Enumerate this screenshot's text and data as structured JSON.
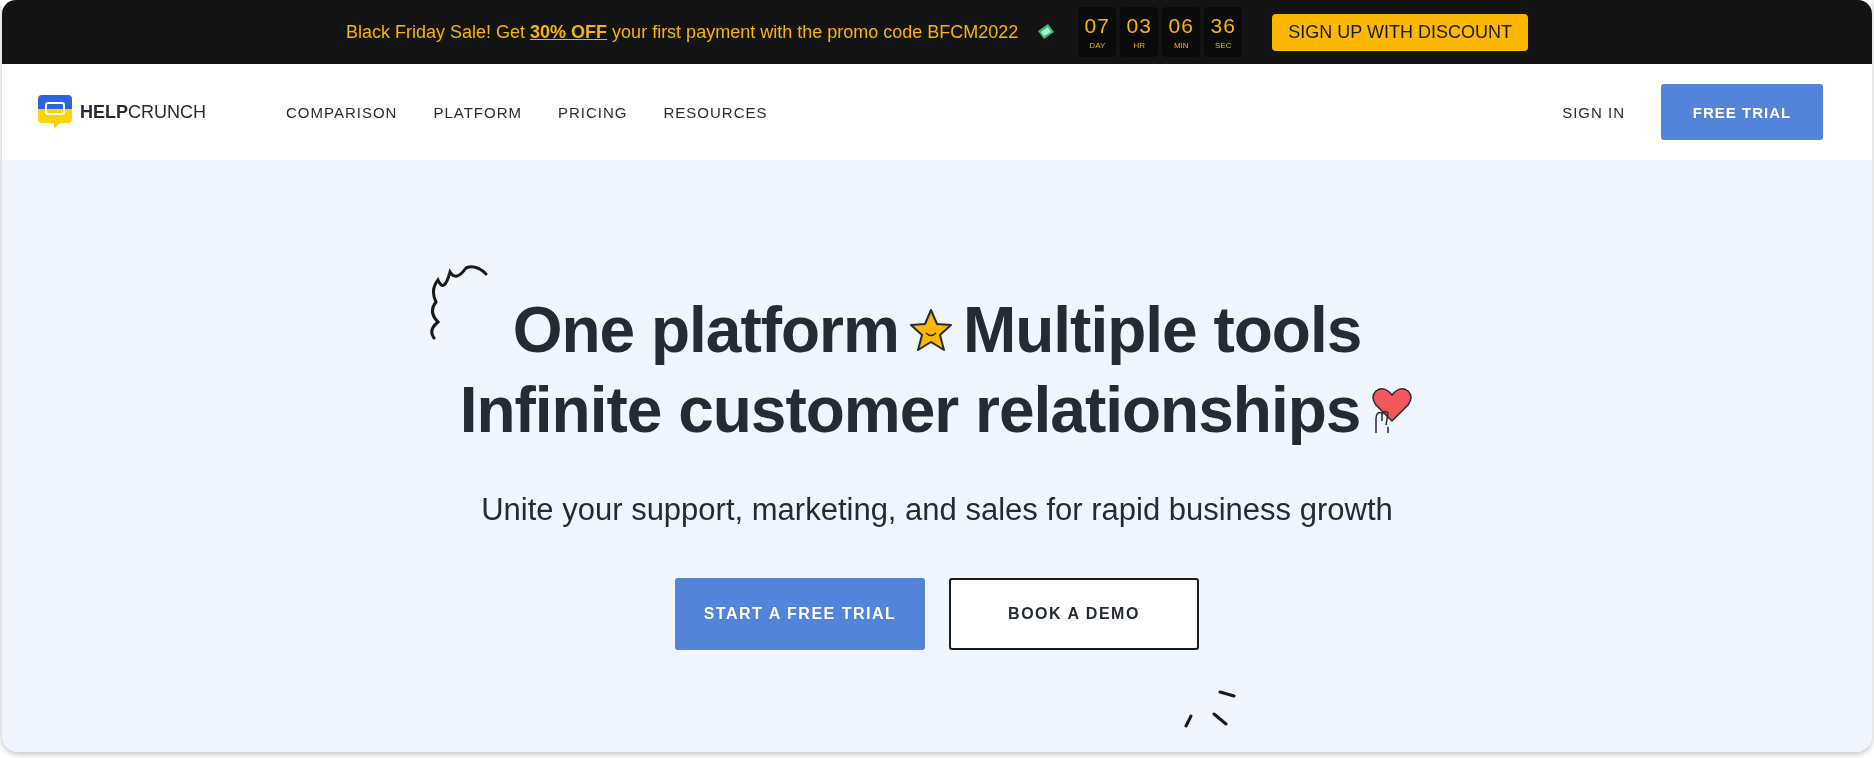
{
  "promo_bar": {
    "message": "Black Friday Sale! Get **30% OFF** your first payment with the promo code BFCM2022",
    "countdown": [
      {
        "value": "07",
        "unit": "DAY"
      },
      {
        "value": "03",
        "unit": "HR"
      },
      {
        "value": "06",
        "unit": "MIN"
      },
      {
        "value": "36",
        "unit": "SEC"
      }
    ],
    "button": "SIGN UP WITH DISCOUNT"
  },
  "nav": {
    "logo": "**HELP**CRUNCH",
    "links": [
      "COMPARISON",
      "PLATFORM",
      "PRICING",
      "RESOURCES"
    ],
    "sign_in": "SIGN IN",
    "trial_button": "FREE TRIAL"
  },
  "hero": {
    "heading_line_1a": "One platform",
    "heading_line_1b": "Multiple tools",
    "heading_line_2": "Infinite customer relationships",
    "subtitle": "Unite your support, marketing, and sales for rapid business growth",
    "buttons": [
      {
        "label": "START A FREE TRIAL",
        "kind": "primary"
      },
      {
        "label": "BOOK A DEMO",
        "kind": "outline"
      }
    ]
  }
}
